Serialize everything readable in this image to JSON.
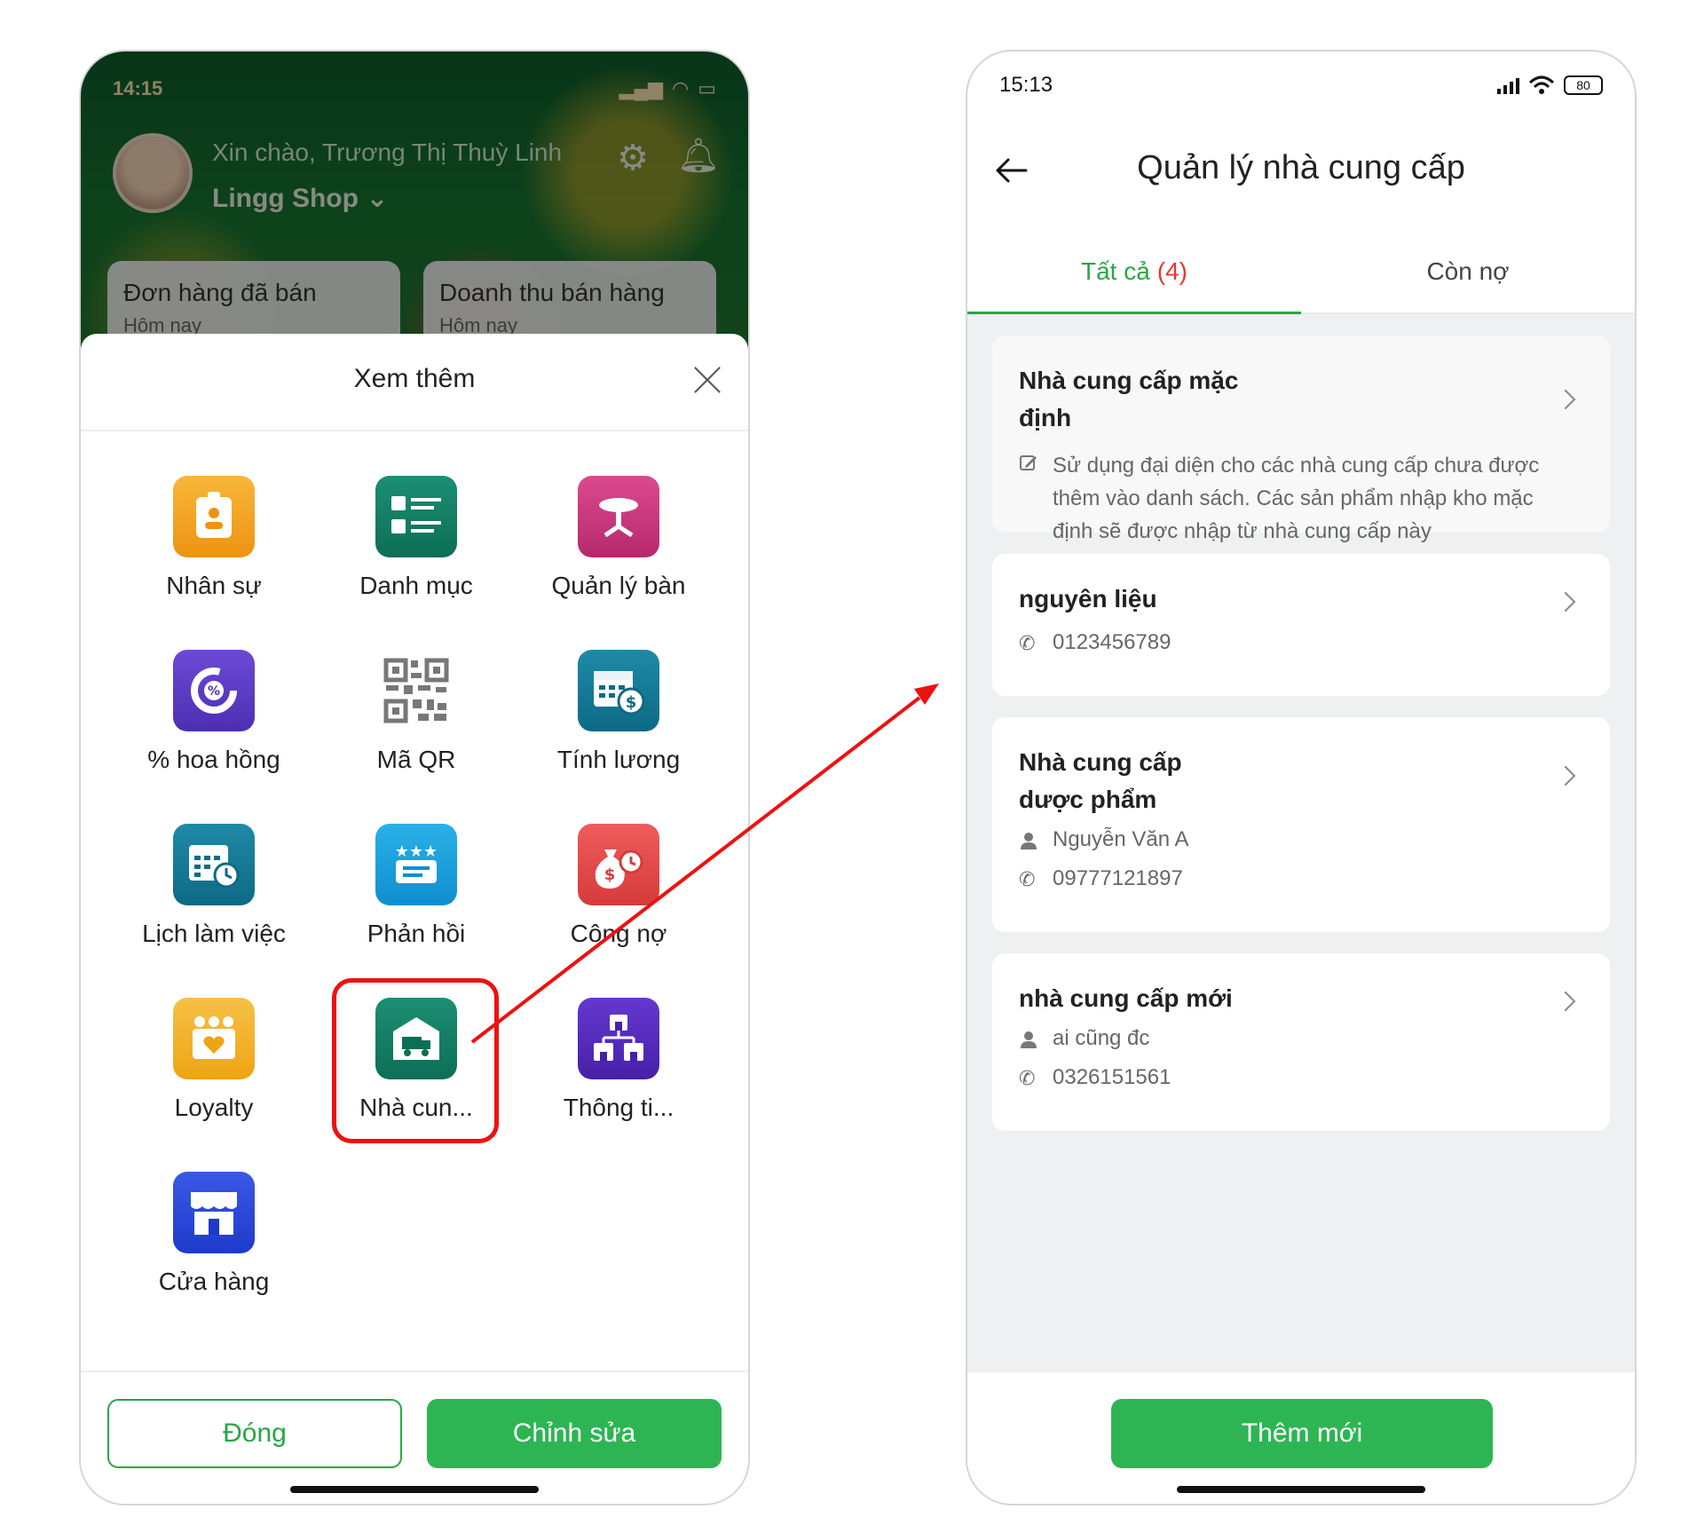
{
  "left_phone": {
    "status_time": "14:15",
    "greeting": "Xin chào, Trương Thị Thuỳ Linh",
    "shop_name": "Lingg Shop",
    "stat_cards": [
      {
        "title": "Đơn hàng đã bán",
        "sub": "Hôm nay"
      },
      {
        "title": "Doanh thu bán hàng",
        "sub": "Hôm nay"
      }
    ],
    "sheet_title": "Xem thêm",
    "menu_items": [
      {
        "label": "Nhân sự",
        "icon": "id-badge-icon",
        "color": "#f0a020"
      },
      {
        "label": "Danh mục",
        "icon": "list-icon",
        "color": "#128066"
      },
      {
        "label": "Quản lý bàn",
        "icon": "table-icon",
        "color": "#c9357b"
      },
      {
        "label": "% hoa hồng",
        "icon": "percent-chart-icon",
        "color": "#5a3ac4"
      },
      {
        "label": "Mã QR",
        "icon": "qr-code-icon",
        "color": "#666666"
      },
      {
        "label": "Tính lương",
        "icon": "salary-calendar-icon",
        "color": "#127a96"
      },
      {
        "label": "Lịch làm việc",
        "icon": "calendar-clock-icon",
        "color": "#127a96"
      },
      {
        "label": "Phản hồi",
        "icon": "feedback-stars-icon",
        "color": "#1ea0dc"
      },
      {
        "label": "Công nợ",
        "icon": "money-bag-icon",
        "color": "#e04848"
      },
      {
        "label": "Loyalty",
        "icon": "loyalty-heart-icon",
        "color": "#f2b22c"
      },
      {
        "label": "Nhà cun...",
        "icon": "supplier-truck-icon",
        "color": "#128066"
      },
      {
        "label": "Thông ti...",
        "icon": "stores-network-icon",
        "color": "#552bbd"
      },
      {
        "label": "Cửa hàng",
        "icon": "storefront-icon",
        "color": "#2c48d8"
      }
    ],
    "close_button": "Đóng",
    "edit_button": "Chỉnh sửa"
  },
  "right_phone": {
    "status_time": "15:13",
    "battery": "80",
    "title": "Quản lý nhà cung cấp",
    "tabs": [
      {
        "label": "Tất cả",
        "count": "(4)"
      },
      {
        "label": "Còn nợ"
      }
    ],
    "suppliers": [
      {
        "name": "Nhà cung cấp mặc định",
        "description": "Sử dụng đại diện cho các nhà cung cấp chưa được thêm vào danh sách. Các sản phẩm nhập kho mặc định sẽ được nhập từ nhà cung cấp này"
      },
      {
        "name": "nguyên liệu",
        "phone": "0123456789"
      },
      {
        "name": "Nhà cung cấp dược phẩm",
        "contact": "Nguyễn Văn A",
        "phone": "09777121897"
      },
      {
        "name": "nhà cung cấp mới",
        "contact": "ai cũng đc",
        "phone": "0326151561"
      }
    ],
    "add_button": "Thêm mới"
  },
  "colors": {
    "accent_green": "#2db553",
    "highlight_red": "#e11111",
    "count_red": "#e53935"
  }
}
